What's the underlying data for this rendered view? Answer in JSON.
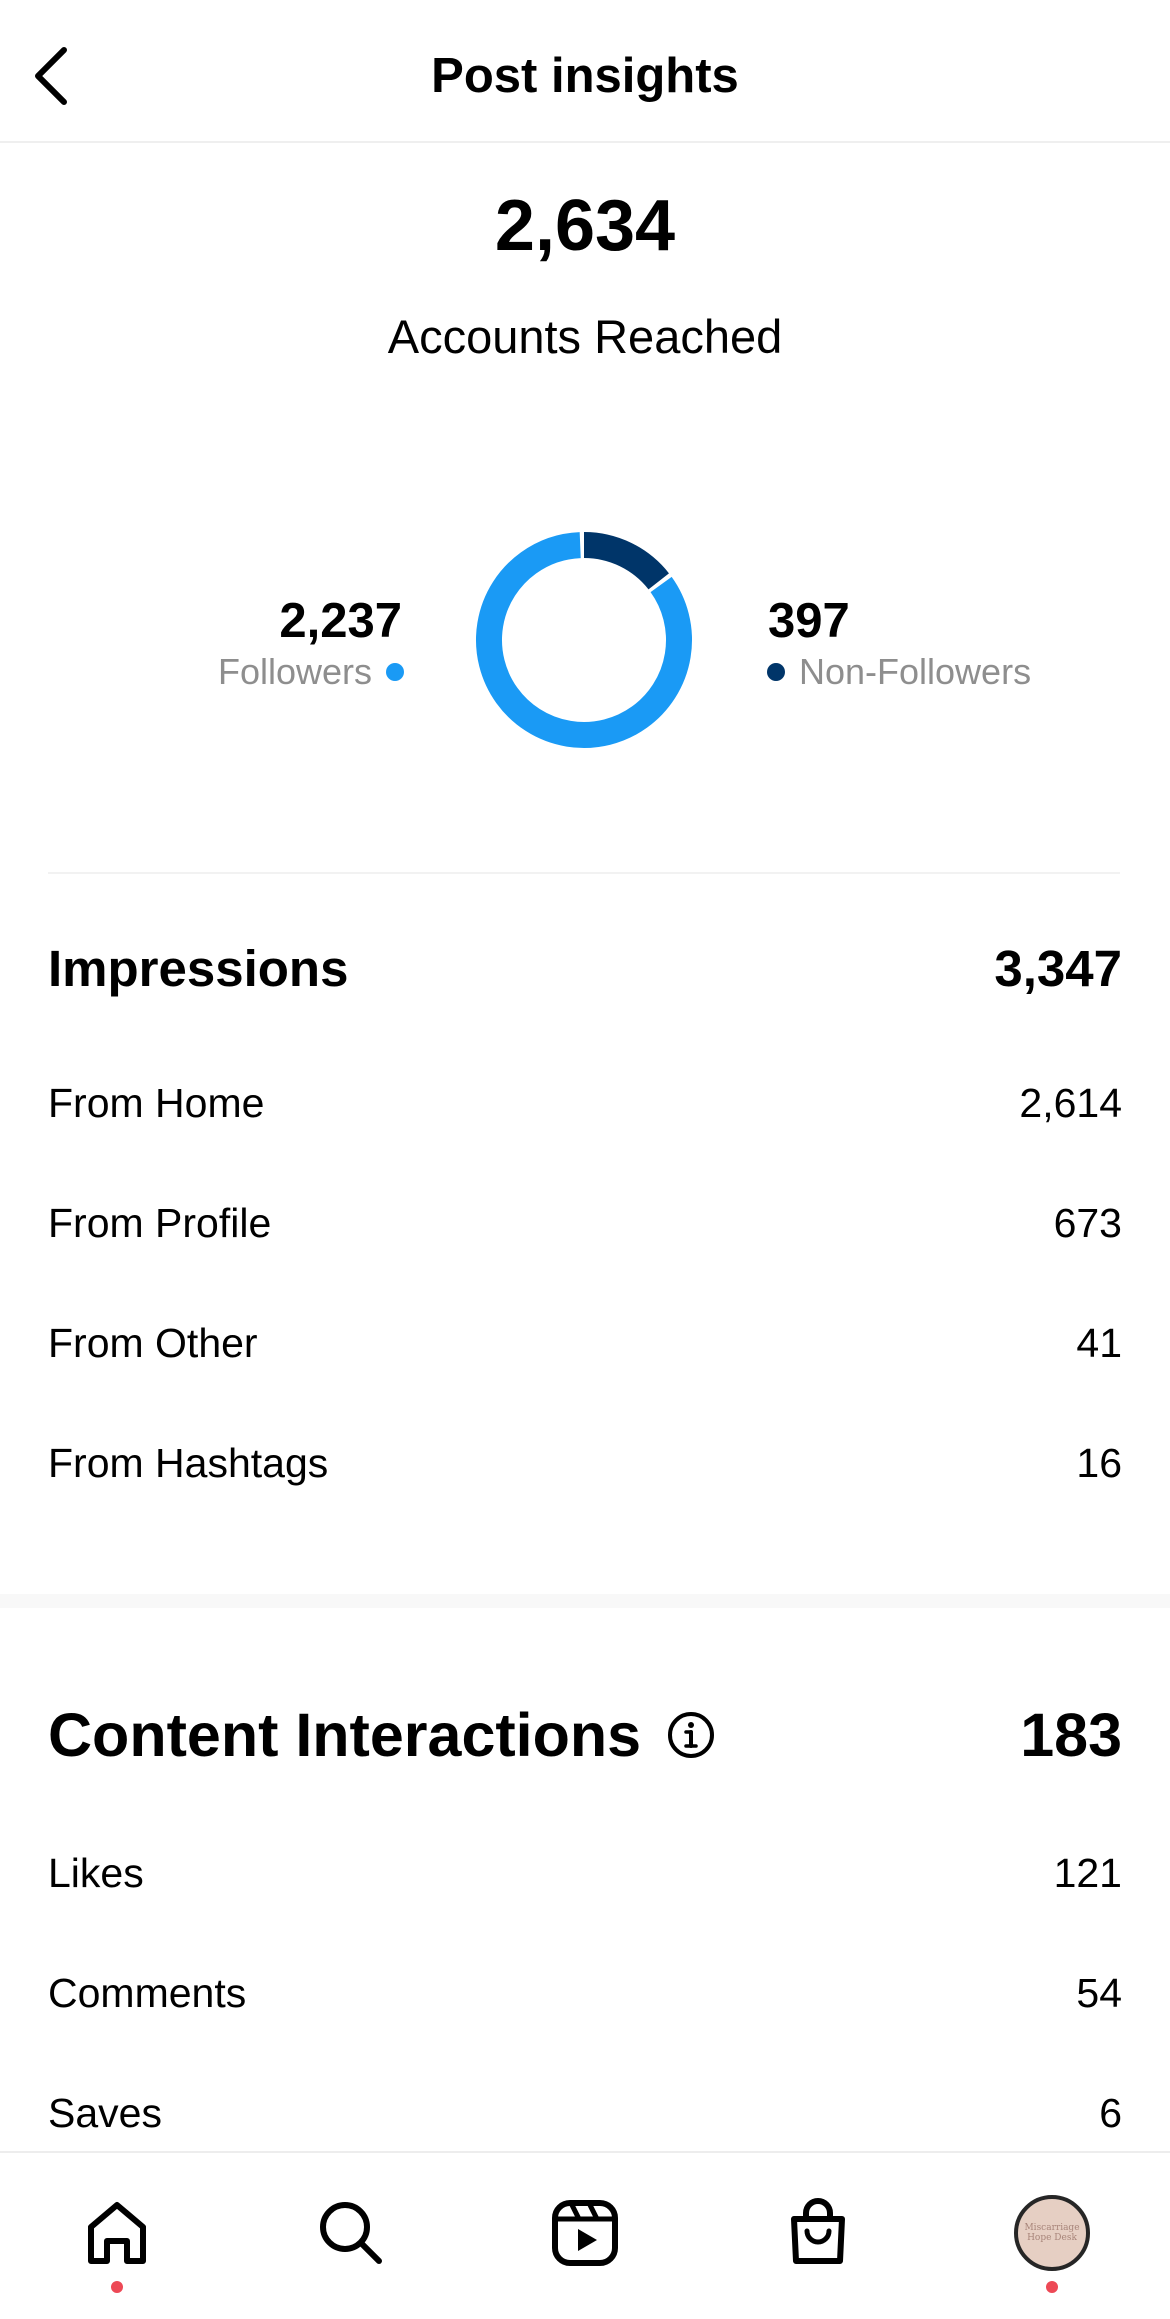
{
  "header": {
    "title": "Post insights"
  },
  "reach": {
    "total": "2,634",
    "label": "Accounts Reached",
    "followers": {
      "value": "2,237",
      "label": "Followers",
      "count": 2237,
      "color": "#1a9af5"
    },
    "non_followers": {
      "value": "397",
      "label": "Non-Followers",
      "count": 397,
      "color": "#003569"
    }
  },
  "impressions": {
    "title": "Impressions",
    "total": "3,347",
    "rows": [
      {
        "label": "From Home",
        "value": "2,614"
      },
      {
        "label": "From Profile",
        "value": "673"
      },
      {
        "label": "From Other",
        "value": "41"
      },
      {
        "label": "From Hashtags",
        "value": "16"
      }
    ]
  },
  "content_interactions": {
    "title": "Content Interactions",
    "total": "183",
    "info_icon": "info-circle-icon",
    "rows": [
      {
        "label": "Likes",
        "value": "121"
      },
      {
        "label": "Comments",
        "value": "54"
      },
      {
        "label": "Saves",
        "value": "6"
      }
    ]
  },
  "bottom_nav": {
    "items": [
      "home-icon",
      "search-icon",
      "reels-icon",
      "shop-icon",
      "profile-avatar"
    ],
    "avatar_text": "Miscarriage Hope Desk",
    "active_dot_color": "#ed4956"
  }
}
